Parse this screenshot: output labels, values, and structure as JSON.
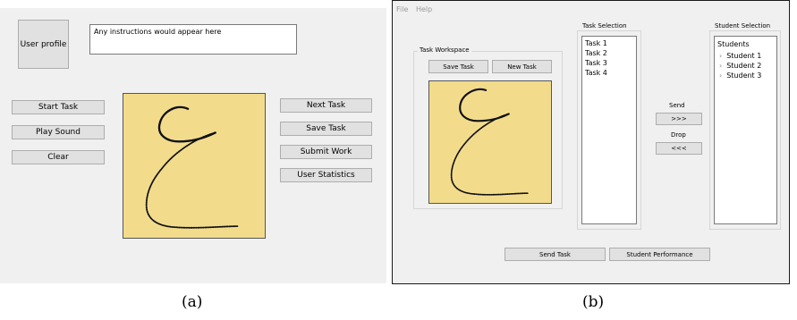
{
  "panel_a": {
    "user_profile": "User profile",
    "instructions": "Any instructions would appear here",
    "left_buttons": [
      "Start Task",
      "Play Sound",
      "Clear"
    ],
    "right_buttons": [
      "Next Task",
      "Save Task",
      "Submit Work",
      "User Statistics"
    ],
    "caption": "(a)"
  },
  "panel_b": {
    "menu": [
      "File",
      "Help"
    ],
    "workspace_label": "Task Workspace",
    "save_task": "Save Task",
    "new_task": "New Task",
    "task_selection_label": "Task Selection",
    "tasks": [
      "Task 1",
      "Task 2",
      "Task 3",
      "Task 4"
    ],
    "send_label": "Send",
    "send_button": ">>>",
    "drop_label": "Drop",
    "drop_button": "<<<",
    "student_selection_label": "Student Selection",
    "students_header": "Students",
    "students": [
      "Student 1",
      "Student 2",
      "Student 3"
    ],
    "send_task": "Send Task",
    "student_performance": "Student Performance",
    "caption": "(b)"
  }
}
